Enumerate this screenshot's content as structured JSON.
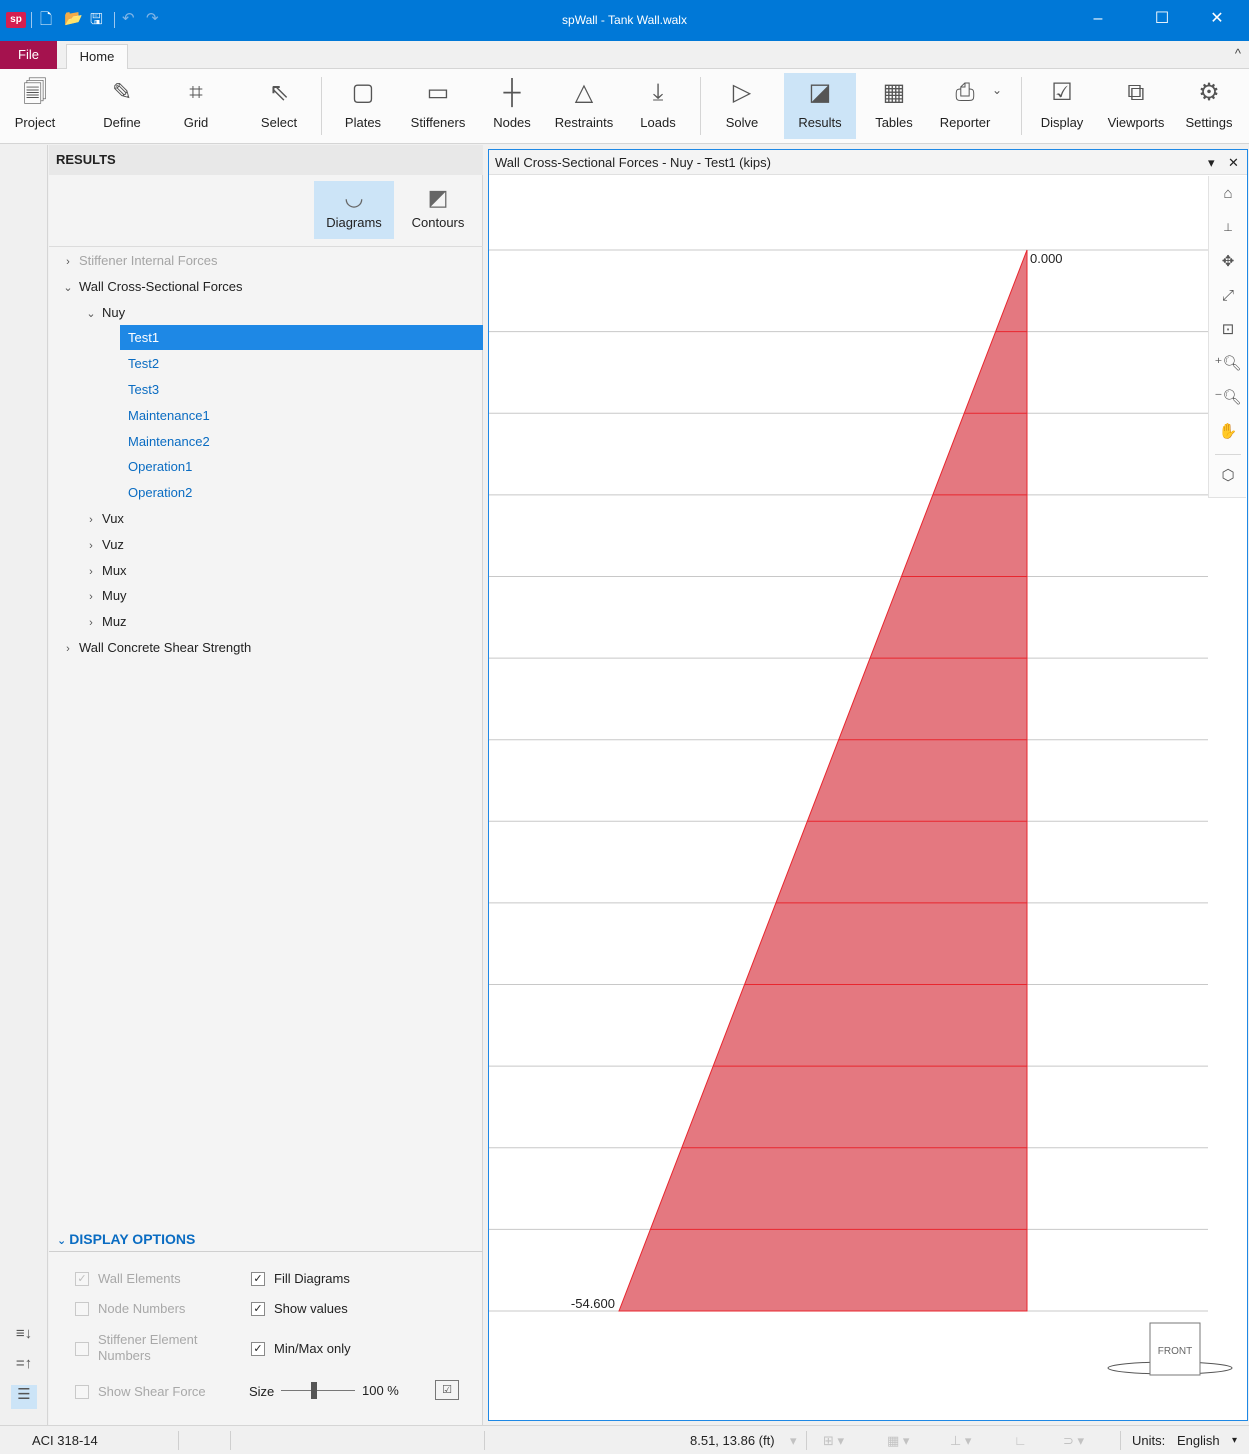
{
  "app": {
    "logo": "sp",
    "title": "spWall - Tank Wall.walx"
  },
  "tabs": {
    "file": "File",
    "home": "Home"
  },
  "ribbon": [
    {
      "label": "Project",
      "icon": "project-icon"
    },
    {
      "label": "Define",
      "icon": "define-icon"
    },
    {
      "label": "Grid",
      "icon": "grid-icon"
    },
    {
      "label": "Select",
      "icon": "select-cursor-icon"
    },
    {
      "label": "Plates",
      "icon": "plates-icon"
    },
    {
      "label": "Stiffeners",
      "icon": "stiffeners-icon"
    },
    {
      "label": "Nodes",
      "icon": "nodes-icon"
    },
    {
      "label": "Restraints",
      "icon": "restraints-icon"
    },
    {
      "label": "Loads",
      "icon": "loads-icon"
    },
    {
      "label": "Solve",
      "icon": "solve-icon"
    },
    {
      "label": "Results",
      "icon": "results-icon",
      "active": true
    },
    {
      "label": "Tables",
      "icon": "tables-icon"
    },
    {
      "label": "Reporter",
      "icon": "reporter-icon"
    },
    {
      "label": "Display",
      "icon": "display-icon"
    },
    {
      "label": "Viewports",
      "icon": "viewports-icon"
    },
    {
      "label": "Settings",
      "icon": "settings-gear-icon"
    }
  ],
  "panel": {
    "title": "RESULTS",
    "modes": [
      {
        "label": "Diagrams",
        "active": true
      },
      {
        "label": "Contours",
        "active": false
      }
    ],
    "tree": [
      {
        "label": "Stiffener Internal Forces",
        "state": "dim",
        "chev": "›"
      },
      {
        "label": "Wall Cross-Sectional Forces",
        "state": "normal",
        "chev": "⌄"
      },
      {
        "label": "Nuy",
        "state": "normal",
        "chev": "⌄"
      },
      {
        "label": "Test1",
        "state": "sel"
      },
      {
        "label": "Test2",
        "state": "link"
      },
      {
        "label": "Test3",
        "state": "link"
      },
      {
        "label": "Maintenance1",
        "state": "link"
      },
      {
        "label": "Maintenance2",
        "state": "link"
      },
      {
        "label": "Operation1",
        "state": "link"
      },
      {
        "label": "Operation2",
        "state": "link"
      },
      {
        "label": "Vux",
        "state": "normal",
        "chev": "›"
      },
      {
        "label": "Vuz",
        "state": "normal",
        "chev": "›"
      },
      {
        "label": "Mux",
        "state": "normal",
        "chev": "›"
      },
      {
        "label": "Muy",
        "state": "normal",
        "chev": "›"
      },
      {
        "label": "Muz",
        "state": "normal",
        "chev": "›"
      },
      {
        "label": "Wall Concrete Shear Strength",
        "state": "normal",
        "chev": "›"
      }
    ],
    "display_options": {
      "header": "DISPLAY OPTIONS",
      "wall_elements": {
        "label": "Wall Elements",
        "checked": true,
        "disabled": true
      },
      "node_numbers": {
        "label": "Node Numbers",
        "checked": false,
        "disabled": true
      },
      "stiffener_element_numbers": {
        "label": "Stiffener Element Numbers",
        "checked": false,
        "disabled": true
      },
      "show_shear_force": {
        "label": "Show Shear Force",
        "checked": false,
        "disabled": true
      },
      "fill_diagrams": {
        "label": "Fill Diagrams",
        "checked": true
      },
      "show_values": {
        "label": "Show values",
        "checked": true
      },
      "min_max_only": {
        "label": "Min/Max only",
        "checked": true
      },
      "size_label": "Size",
      "size_value": "100 %",
      "size_fraction": 0.45
    }
  },
  "viewport": {
    "title": "Wall Cross-Sectional Forces - Nuy - Test1 (kips)",
    "max_label": "0.000",
    "min_label": "-54.600",
    "top_value": 0.0,
    "bottom_value": -54.6,
    "segments": 13,
    "fill_color": "#e47880",
    "line_color": "#e8262e",
    "cube_label": "FRONT"
  },
  "status": {
    "code": "ACI 318-14",
    "coords": "8.51, 13.86 (ft)",
    "units_label": "Units:",
    "units_value": "English"
  }
}
